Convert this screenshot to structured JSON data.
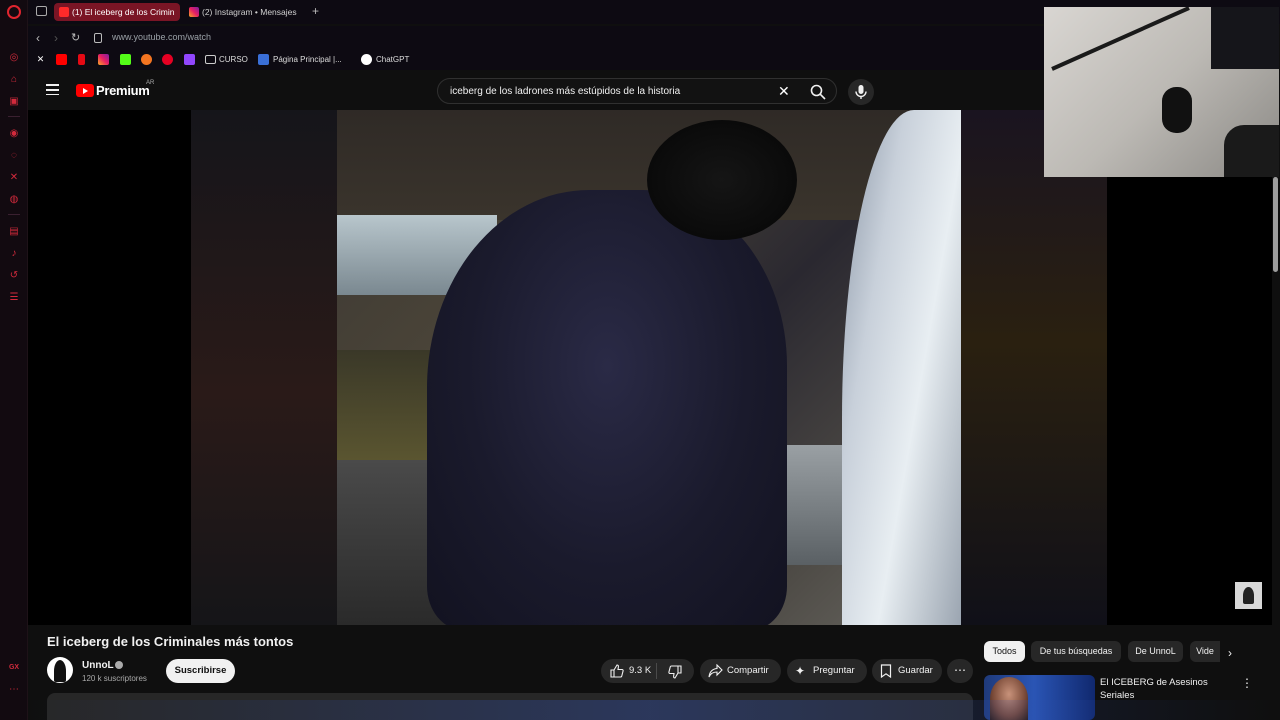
{
  "browser": {
    "tabs": [
      {
        "label": "(1) El iceberg de los Crimin",
        "active": true
      },
      {
        "label": "(2) Instagram • Mensajes",
        "active": false
      }
    ],
    "new_tab": "+",
    "url": "www.youtube.com/watch",
    "bookmarks": [
      {
        "icon": "x-icon",
        "label": ""
      },
      {
        "icon": "youtube-icon",
        "label": ""
      },
      {
        "icon": "bookmark-red-icon",
        "label": ""
      },
      {
        "icon": "instagram-icon",
        "label": ""
      },
      {
        "icon": "kick-icon",
        "label": ""
      },
      {
        "icon": "crunchyroll-icon",
        "label": ""
      },
      {
        "icon": "pinterest-icon",
        "label": ""
      },
      {
        "icon": "twitch-icon",
        "label": ""
      },
      {
        "icon": "folder-icon",
        "label": "CURSO"
      },
      {
        "icon": "site-icon",
        "label": "Página Principal |..."
      },
      {
        "icon": "chatgpt-icon",
        "label": "ChatGPT"
      }
    ],
    "sidebar_bottom_label": "GX"
  },
  "youtube": {
    "logo_text": "Premium",
    "region": "AR",
    "search": {
      "query": "iceberg de los ladrones más estúpidos de la historia"
    },
    "video": {
      "title": "El iceberg de los Criminales más tontos",
      "channel": "UnnoL",
      "subscribers": "120 k suscriptores",
      "subscribe_label": "Suscribirse",
      "likes": "9.3 K",
      "share_label": "Compartir",
      "ask_label": "Preguntar",
      "save_label": "Guardar"
    },
    "chips": [
      "Todos",
      "De tus búsquedas",
      "De UnnoL",
      "Vide"
    ],
    "recommendation": {
      "title": "El ICEBERG de Asesinos Seriales"
    }
  },
  "colors": {
    "accent_red": "#ff0000",
    "opera_red": "#e0252f",
    "active_tab": "#7a1525",
    "background": "#0f0f0f"
  }
}
